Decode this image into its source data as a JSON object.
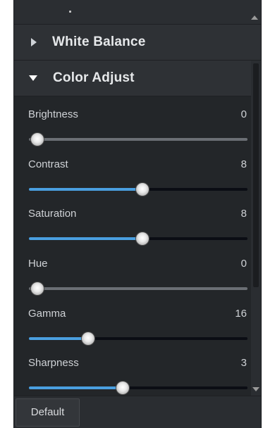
{
  "sections": {
    "white_balance": {
      "title": "White Balance",
      "expanded": false
    },
    "color_adjust": {
      "title": "Color Adjust",
      "expanded": true
    }
  },
  "sliders": [
    {
      "label": "Brightness",
      "value": "0",
      "fill_fraction": 0.04
    },
    {
      "label": "Contrast",
      "value": "8",
      "fill_fraction": 0.52
    },
    {
      "label": "Saturation",
      "value": "8",
      "fill_fraction": 0.52
    },
    {
      "label": "Hue",
      "value": "0",
      "fill_fraction": 0.04
    },
    {
      "label": "Gamma",
      "value": "16",
      "fill_fraction": 0.27
    },
    {
      "label": "Sharpness",
      "value": "3",
      "fill_fraction": 0.43
    }
  ],
  "footer": {
    "default_label": "Default"
  },
  "colors": {
    "accent": "#4a9fe0",
    "panel": "#2a2d31",
    "content": "#232629"
  }
}
